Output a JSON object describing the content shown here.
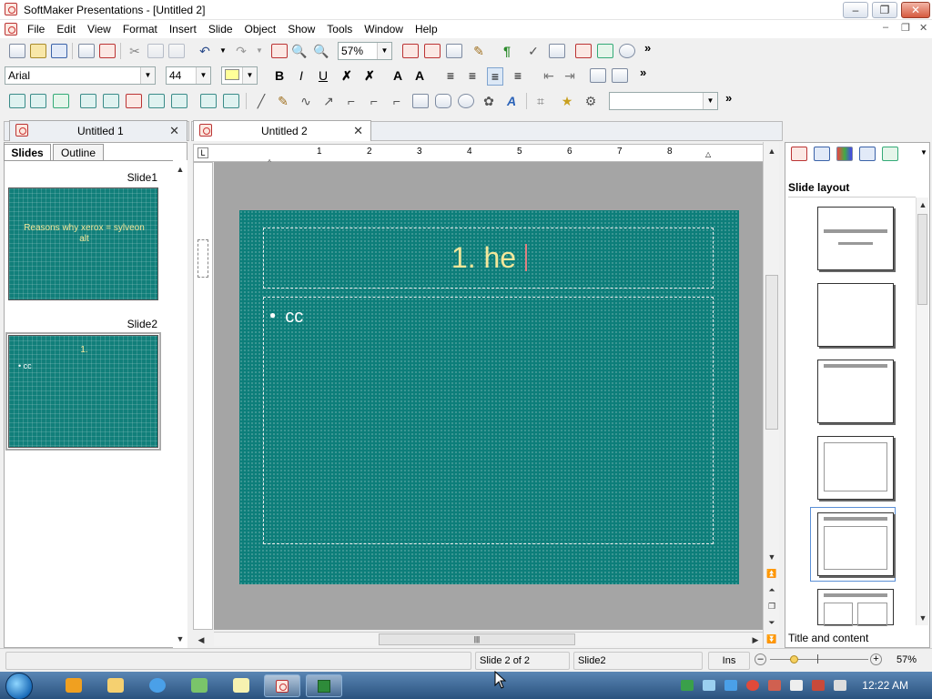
{
  "window": {
    "title": "SoftMaker Presentations - [Untitled 2]"
  },
  "menu": [
    "File",
    "Edit",
    "View",
    "Format",
    "Insert",
    "Slide",
    "Object",
    "Show",
    "Tools",
    "Window",
    "Help"
  ],
  "toolbar": {
    "zoom": "57%",
    "font": "Arial",
    "font_size": "44",
    "more": "»"
  },
  "doc_tabs": [
    {
      "label": "Untitled 1"
    },
    {
      "label": "Untitled 2"
    }
  ],
  "side_tabs": {
    "slides": "Slides",
    "outline": "Outline"
  },
  "thumbnails": [
    {
      "label": "Slide1",
      "title": "Reasons why xerox = sylveon alt"
    },
    {
      "label": "Slide2",
      "title": "1.",
      "bullet": "• cc"
    }
  ],
  "ruler_ticks": [
    "1",
    "2",
    "3",
    "4",
    "5",
    "6",
    "7",
    "8"
  ],
  "slide": {
    "title": "1. he",
    "bullet": "cc",
    "bg_color": "#0d7e7a",
    "title_color": "#f3e79a"
  },
  "right_pane": {
    "header": "Slide layout",
    "footer": "Title and content"
  },
  "status": {
    "slide_pos": "Slide 2 of 2",
    "slide_name": "Slide2",
    "mode": "Ins",
    "zoom": "57%"
  },
  "taskbar": {
    "time": "12:22 AM"
  }
}
